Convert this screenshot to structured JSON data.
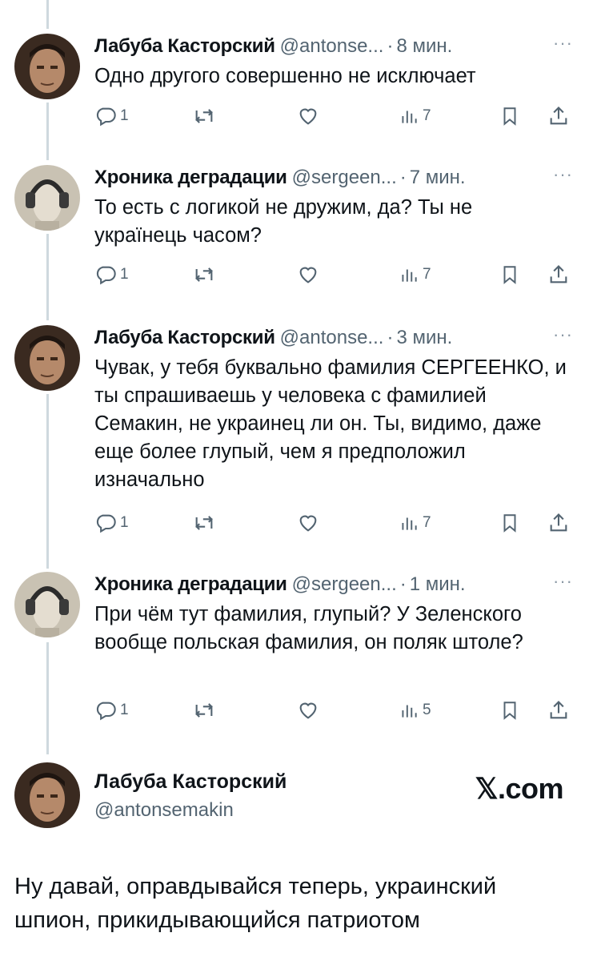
{
  "tweets": [
    {
      "name": "Лабуба Касторский",
      "handle": "@antonse...",
      "time": "8 мин.",
      "more": "···",
      "text": "Одно другого совершенно не исключает",
      "replies": "1",
      "reposts": "",
      "likes": "",
      "views": "7"
    },
    {
      "name": "Хроника деградации",
      "handle": "@sergeen...",
      "time": "7 мин.",
      "more": "···",
      "text": "То есть с логикой не дружим, да? Ты не українець часом?",
      "replies": "1",
      "reposts": "",
      "likes": "",
      "views": "7"
    },
    {
      "name": "Лабуба Касторский",
      "handle": "@antonse...",
      "time": "3 мин.",
      "more": "···",
      "text": "Чувак, у тебя буквально фамилия СЕРГЕЕНКО, и ты спрашиваешь у человека с фамилией Семакин, не украинец ли он. Ты, видимо, даже еще более глупый, чем я предположил изначально",
      "replies": "1",
      "reposts": "",
      "likes": "",
      "views": "7"
    },
    {
      "name": "Хроника деградации",
      "handle": "@sergeen...",
      "time": "1 мин.",
      "more": "···",
      "text": "При чём тут фамилия, глупый? У Зеленского вообще польская фамилия, он поляк штоле?",
      "replies": "1",
      "reposts": "",
      "likes": "",
      "views": "5"
    }
  ],
  "main_tweet": {
    "name": "Лабуба Касторский",
    "handle": "@antonsemakin",
    "brand": "𝕏.com",
    "text": "Ну давай, оправдывайся теперь, украинский шпион, прикидывающийся патриотом"
  },
  "colors": {
    "text": "#0f1419",
    "secondary": "#536471",
    "thread_line": "#cfd9de"
  }
}
